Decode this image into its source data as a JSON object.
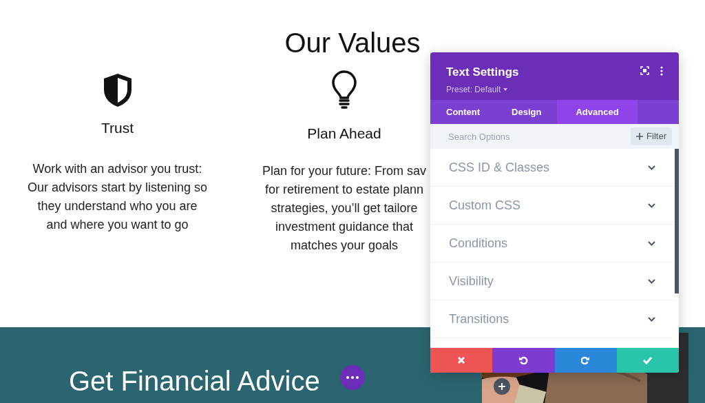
{
  "heading": "Our Values",
  "values": [
    {
      "kind": "shield",
      "title": "Trust",
      "text": "Work with an advisor you trust:\nOur advisors start by listening so\nthey understand who you are\nand where you want to go"
    },
    {
      "kind": "bulb",
      "title": "Plan Ahead",
      "text": "Plan for your future: From sav\nfor retirement to estate plann\nstrategies, you’ll get tailore\ninvestment guidance that\nmatches your goals"
    }
  ],
  "panel": {
    "title": "Text Settings",
    "preset": "Preset: Default",
    "tabs": [
      {
        "label": "Content",
        "selected": false
      },
      {
        "label": "Design",
        "selected": false
      },
      {
        "label": "Advanced",
        "selected": true
      }
    ],
    "search": {
      "placeholder": "Search Options"
    },
    "filter": "Filter",
    "sections": [
      "CSS ID & Classes",
      "Custom CSS",
      "Conditions",
      "Visibility",
      "Transitions"
    ],
    "actions": [
      {
        "kind": "cancel"
      },
      {
        "kind": "undo"
      },
      {
        "kind": "redo"
      },
      {
        "kind": "save"
      }
    ]
  },
  "banner": {
    "title": "Get Financial Advice"
  }
}
